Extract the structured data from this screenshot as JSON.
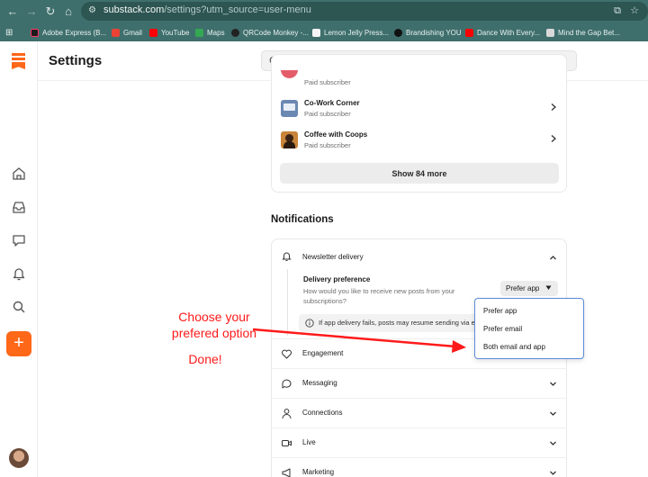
{
  "browser": {
    "url_main": "substack.com",
    "url_path": "/settings?utm_source=user-menu",
    "bookmarks": [
      {
        "label": "Adobe Express (B...",
        "color": "#1b1b1b"
      },
      {
        "label": "Gmail",
        "color": "#ea4335"
      },
      {
        "label": "YouTube",
        "color": "#ff0000"
      },
      {
        "label": "Maps",
        "color": "#34a853"
      },
      {
        "label": "QRCode Monkey -...",
        "color": "#222222"
      },
      {
        "label": "Lemon Jelly Press...",
        "color": "#f5f5f5"
      },
      {
        "label": "Brandishing YOU",
        "color": "#111111"
      },
      {
        "label": "Dance With Every...",
        "color": "#ff0000"
      },
      {
        "label": "Mind the Gap Bet...",
        "color": "#d9d9d9"
      }
    ]
  },
  "header": {
    "title": "Settings",
    "search_placeholder": "Search Substack"
  },
  "subscriptions": {
    "partial_meta": "Paid subscriber",
    "items": [
      {
        "name": "Co-Work Corner",
        "meta": "Paid subscriber",
        "thumb_color": "#6b88b3"
      },
      {
        "name": "Coffee with Coops",
        "meta": "Paid subscriber",
        "thumb_color": "#c8843a"
      }
    ],
    "show_more": "Show 84 more"
  },
  "notifications": {
    "title": "Notifications",
    "newsletter_delivery": {
      "label": "Newsletter delivery",
      "pref_title": "Delivery preference",
      "pref_desc": "How would you like to receive new posts from your subscriptions?",
      "selected": "Prefer app",
      "warning": "If app delivery fails, posts may resume sending via email"
    },
    "dropdown_options": [
      "Prefer app",
      "Prefer email",
      "Both email and app"
    ],
    "rows": [
      "Engagement",
      "Messaging",
      "Connections",
      "Live",
      "Marketing"
    ]
  },
  "annotation": {
    "line1": "Choose your",
    "line2": "prefered option",
    "line3": "Done!"
  },
  "colors": {
    "brand": "#ff6719",
    "annotation": "#ff1a1a",
    "chrome": "#3f6f6c"
  }
}
